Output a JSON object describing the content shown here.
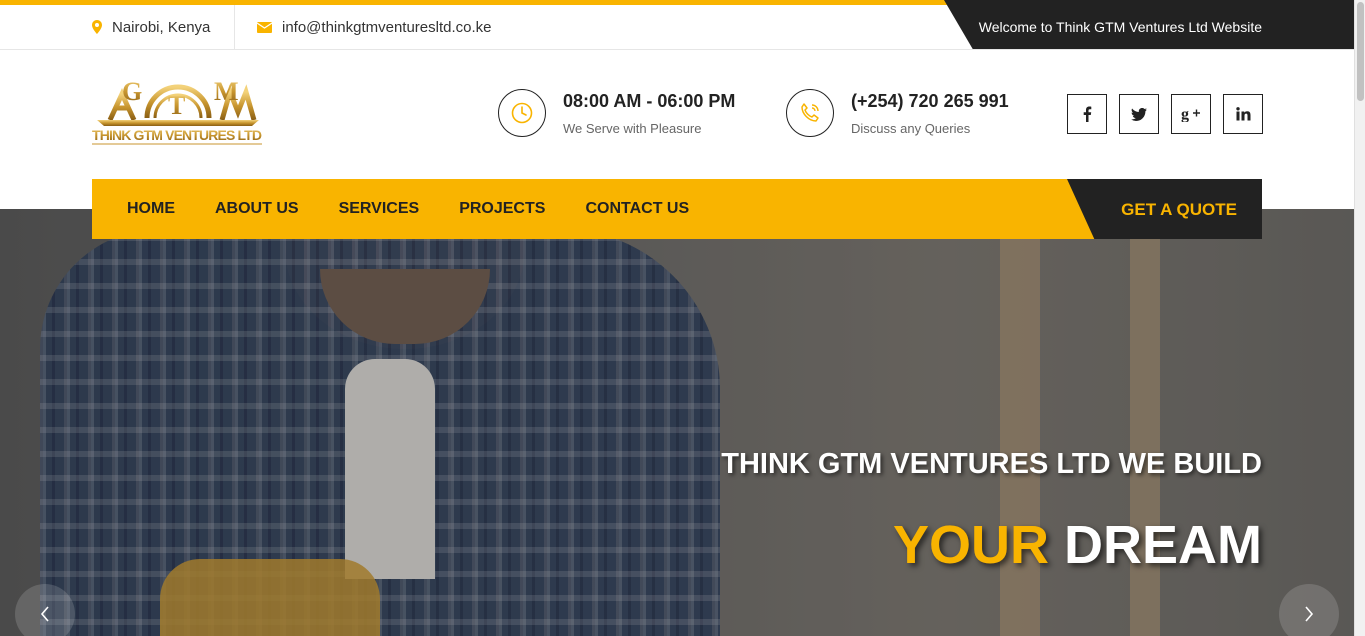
{
  "topbar": {
    "location": "Nairobi, Kenya",
    "email": "info@thinkgtmventuresltd.co.ke",
    "welcome": "Welcome to Think GTM Ventures Ltd Website"
  },
  "logo": {
    "initials": "GTM",
    "name": "THINK GTM VENTURES LTD"
  },
  "header": {
    "hours_title": "08:00 AM - 06:00 PM",
    "hours_sub": "We Serve with Pleasure",
    "phone_title": "(+254) 720 265 991",
    "phone_sub": "Discuss any Queries"
  },
  "socials": [
    {
      "name": "facebook-icon",
      "glyph": "f"
    },
    {
      "name": "twitter-icon",
      "glyph": "t"
    },
    {
      "name": "google-plus-icon",
      "glyph": "g+"
    },
    {
      "name": "linkedin-icon",
      "glyph": "in"
    }
  ],
  "nav": {
    "items": [
      "HOME",
      "ABOUT US",
      "SERVICES",
      "PROJECTS",
      "CONTACT US"
    ],
    "quote": "GET A QUOTE"
  },
  "hero": {
    "line1": "THINK GTM VENTURES LTD WE BUILD",
    "line2_accent": "YOUR",
    "line2_rest": "DREAM"
  },
  "colors": {
    "accent": "#f9b400",
    "dark": "#222222"
  }
}
